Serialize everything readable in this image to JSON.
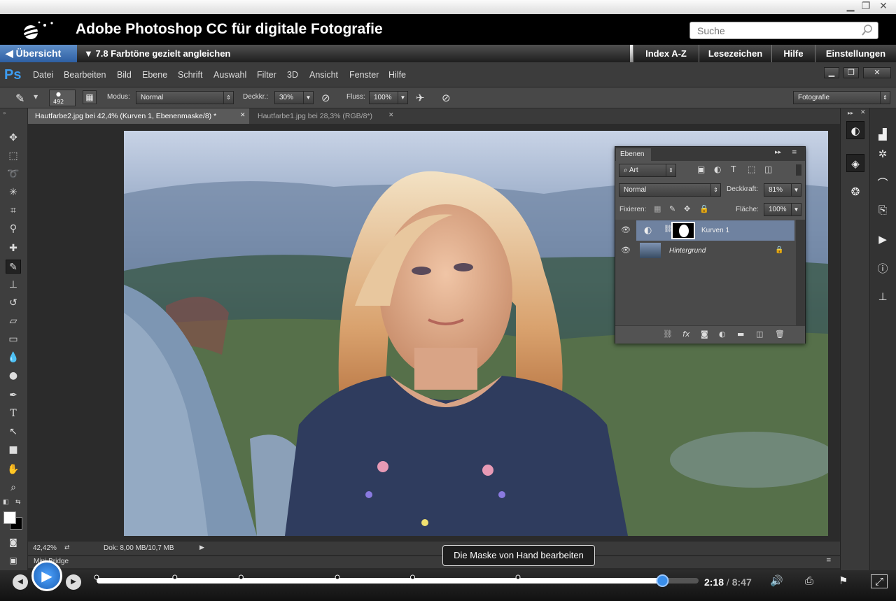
{
  "app": {
    "title": "Adobe Photoshop CC für digitale Fotografie",
    "search_placeholder": "Suche"
  },
  "nav": {
    "back_label": "Übersicht",
    "chapter_label": "7.8 Farbtöne gezielt angleichen",
    "buttons": [
      "Index A-Z",
      "Lesezeichen",
      "Hilfe",
      "Einstellungen"
    ]
  },
  "photoshop": {
    "logo": "Ps",
    "menu": [
      "Datei",
      "Bearbeiten",
      "Bild",
      "Ebene",
      "Schrift",
      "Auswahl",
      "Filter",
      "3D",
      "Ansicht",
      "Fenster",
      "Hilfe"
    ],
    "options": {
      "brush_size": "492",
      "mode_label": "Modus:",
      "mode_value": "Normal",
      "opacity_label": "Deckkr.:",
      "opacity_value": "30%",
      "flow_label": "Fluss:",
      "flow_value": "100%",
      "workspace": "Fotografie"
    },
    "tabs": [
      {
        "label": "Hautfarbe2.jpg bei 42,4% (Kurven 1, Ebenenmaske/8) *",
        "active": true
      },
      {
        "label": "Hautfarbe1.jpg bei 28,3% (RGB/8*)",
        "active": false
      }
    ],
    "layers_panel": {
      "title": "Ebenen",
      "filter_label": "Art",
      "blend_mode": "Normal",
      "opacity_label": "Deckkraft:",
      "opacity_value": "81%",
      "lock_label": "Fixieren:",
      "fill_label": "Fläche:",
      "fill_value": "100%",
      "layers": [
        {
          "name": "Kurven 1",
          "selected": true
        },
        {
          "name": "Hintergrund",
          "selected": false
        }
      ]
    },
    "status": {
      "zoom": "42,42%",
      "doc": "Dok: 8,00 MB/10,7 MB"
    },
    "minibridge_label": "Mini Bridge"
  },
  "player": {
    "tooltip": "Die Maske von Hand bearbeiten",
    "current_time": "2:18",
    "total_time": "8:47",
    "progress": 0.94,
    "chapter_markers": [
      0.0,
      0.26,
      0.48,
      0.8,
      1.05,
      1.4
    ]
  }
}
